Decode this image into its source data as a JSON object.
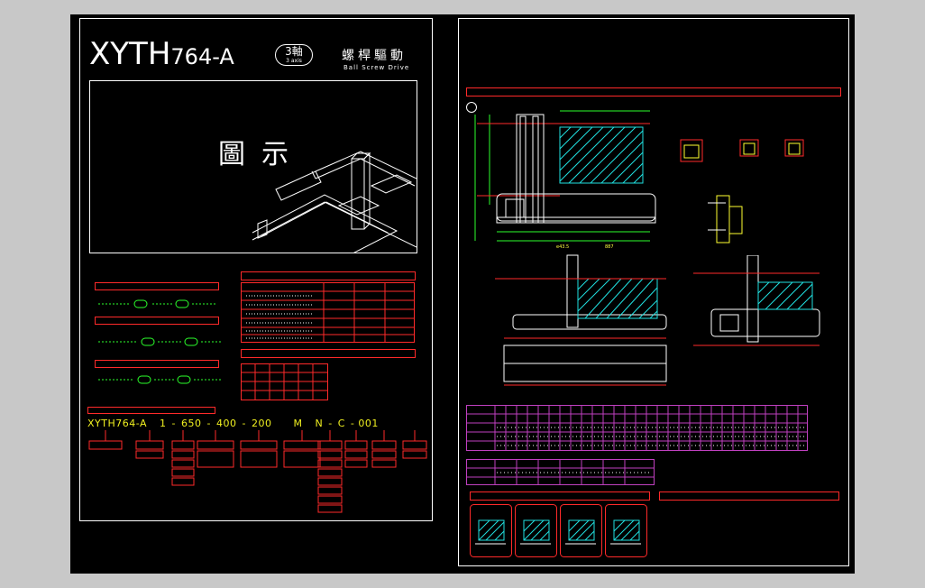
{
  "left_sheet": {
    "model": "XYTH",
    "model_suffix": "764-A",
    "axis_badge": "3軸",
    "axis_badge_sub": "3 axis",
    "drive_cn": "螺桿驅動",
    "drive_en": "Ball Screw Drive",
    "figure_label": "圖示",
    "code": {
      "segments": [
        "XYTH764",
        "-",
        "A",
        "1",
        "-",
        "650",
        "-",
        "400",
        "-",
        "200",
        "M",
        "N",
        "-",
        "C",
        "-",
        "001"
      ]
    }
  },
  "right_sheet": {
    "dim_left_bottom": "e43.5",
    "dim_right_bottom": "887"
  }
}
